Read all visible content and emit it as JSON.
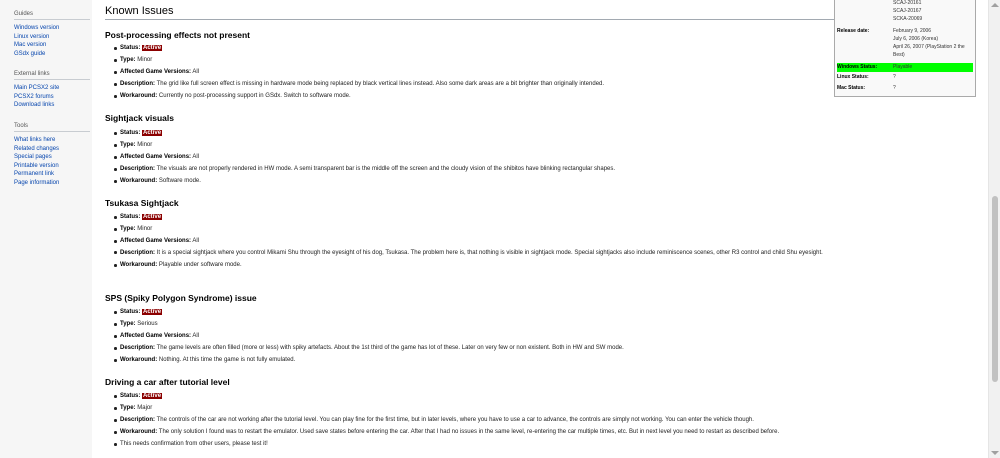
{
  "sidebar": {
    "guides": {
      "heading": "Guides",
      "links": [
        "Windows version",
        "Linux version",
        "Mac version",
        "GSdx guide"
      ]
    },
    "external": {
      "heading": "External links",
      "links": [
        "Main PCSX2 site",
        "PCSX2 forums",
        "Download links"
      ]
    },
    "tools": {
      "heading": "Tools",
      "links": [
        "What links here",
        "Related changes",
        "Special pages",
        "Printable version",
        "Permanent link",
        "Page information"
      ]
    }
  },
  "main": {
    "section_title": "Known Issues",
    "issues": [
      {
        "title": "Post-processing effects not present",
        "status_label": "Status:",
        "status": "Active",
        "type_label": "Type:",
        "type": "Minor",
        "versions_label": "Affected Game Versions:",
        "versions": "All",
        "description_label": "Description:",
        "description": "The grid like full screen effect is missing in hardware mode being replaced by black vertical lines instead. Also some dark areas are a bit brighter than originally intended.",
        "workaround_label": "Workaround:",
        "workaround": "Currently no post-processing support in GSdx. Switch to software mode."
      },
      {
        "title": "Sightjack visuals",
        "status_label": "Status:",
        "status": "Active",
        "type_label": "Type:",
        "type": "Minor",
        "versions_label": "Affected Game Versions:",
        "versions": "All",
        "description_label": "Description:",
        "description": "The visuals are not properly rendered in HW mode. A semi transparent bar is the middle off the screen and the cloudy vision of the shibitos have blinking rectangular shapes.",
        "workaround_label": "Workaround:",
        "workaround": "Software mode."
      },
      {
        "title": "Tsukasa Sightjack",
        "status_label": "Status:",
        "status": "Active",
        "type_label": "Type:",
        "type": "Minor",
        "versions_label": "Affected Game Versions:",
        "versions": "All",
        "description_label": "Description:",
        "description": "It is a special sightjack where you control Mikami Shu through the eyesight of his dog, Tsukasa. The problem here is, that nothing is visible in sightjack mode. Special sightjacks also include reminiscence scenes, other R3 control and child Shu eyesight.",
        "workaround_label": "Workaround:",
        "workaround": "Playable under software mode."
      },
      {
        "title": "SPS (Spiky Polygon Syndrome) issue",
        "status_label": "Status:",
        "status": "Active",
        "type_label": "Type:",
        "type": "Serious",
        "versions_label": "Affected Game Versions:",
        "versions": "All",
        "description_label": "Description:",
        "description": "The game levels are often filled (more or less) with spiky artefacts. About the 1st third of the game has lot of these. Later on very few or non existent. Both in HW and SW mode.",
        "workaround_label": "Workaround:",
        "workaround": "Nothing. At this time the game is not fully emulated."
      },
      {
        "title": "Driving a car after tutorial level",
        "status_label": "Status:",
        "status": "Active",
        "type_label": "Type:",
        "type": "Major",
        "description_label": "Description:",
        "description": "The controls of the car are not working after the tutorial level. You can play fine for the first time, but in later levels, where you have to use a car to advance, the controls are simply not working. You can enter the vehicle though.",
        "workaround_label": "Workaround:",
        "workaround": "The only solution I found was to restart the emulator. Used save states before entering the car. After that I had no issues in the same level, re-entering the car multiple times, etc. But in next level you need to restart as described before.",
        "note": "This needs confirmation from other users, please test it!"
      }
    ]
  },
  "infobox": {
    "serials": [
      "SCAJ-20161",
      "SCAJ-20167",
      "SCKA-20069"
    ],
    "release_label": "Release date:",
    "release_lines": [
      "February 9, 2006",
      "July 6, 2006 (Korea)",
      "April 26, 2007 (PlayStation 2 the",
      "Best)"
    ],
    "windows_label": "Windows Status:",
    "windows_value": "Playable",
    "linux_label": "Linux Status:",
    "linux_value": "?",
    "mac_label": "Mac Status:",
    "mac_value": "?",
    "playable_color": "#00ff00"
  },
  "colors": {
    "link": "#0645ad",
    "status_badge": "#8b0000"
  }
}
